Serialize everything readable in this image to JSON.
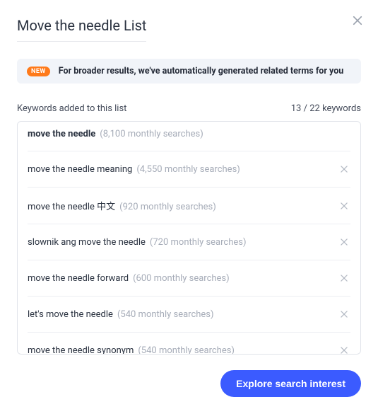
{
  "modal": {
    "title": "Move the needle List"
  },
  "banner": {
    "badge": "NEW",
    "text": "For broader results, we've automatically generated related terms for you"
  },
  "list_header": {
    "label": "Keywords added to this list",
    "count_current": "13",
    "count_total": "22",
    "count_suffix": "keywords"
  },
  "keywords": [
    {
      "name": "move the needle",
      "meta": "(8,100 monthly searches)",
      "removable": false
    },
    {
      "name": "move the needle meaning",
      "meta": "(4,550 monthly searches)",
      "removable": true
    },
    {
      "name": "move the needle 中文",
      "meta": "(920 monthly searches)",
      "removable": true
    },
    {
      "name": "slownik ang move the needle",
      "meta": "(720 monthly searches)",
      "removable": true
    },
    {
      "name": "move the needle forward",
      "meta": "(600 monthly searches)",
      "removable": true
    },
    {
      "name": "let's move the needle",
      "meta": "(540 monthly searches)",
      "removable": true
    },
    {
      "name": "move the needle synonym",
      "meta": "(540 monthly searches)",
      "removable": true
    }
  ],
  "footer": {
    "cta": "Explore search interest"
  }
}
